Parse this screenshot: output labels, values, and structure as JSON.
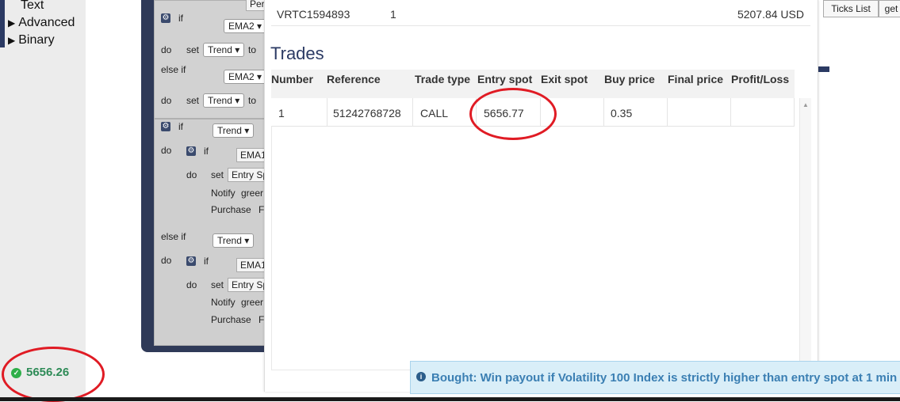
{
  "toolbox": {
    "categories": [
      "Text",
      "Advanced",
      "Binary"
    ],
    "status_value": "5656.26"
  },
  "workspace": {
    "blocks": {
      "if": "if",
      "do": "do",
      "else_if": "else if",
      "set": "set",
      "to": "to",
      "notify": "Notify",
      "purchase": "Purchase",
      "trend": "Trend",
      "ema2": "EMA2",
      "ema1_trunc": "EMA1",
      "entry_trunc": "Entry Sp",
      "green_trunc": "greer",
      "purchase_trunc": "F",
      "top_trunc": "Per"
    },
    "ticks_list_label": "Ticks List",
    "get_label": "get"
  },
  "summary": {
    "account": "VRTC1594893",
    "count": "1",
    "balance": "5207.84 USD"
  },
  "trades": {
    "title": "Trades",
    "columns": [
      "Number",
      "Reference",
      "Trade type",
      "Entry spot",
      "Exit spot",
      "Buy price",
      "Final price",
      "Profit/Loss"
    ],
    "rows": [
      {
        "number": "1",
        "reference": "51242768728",
        "trade_type": "CALL",
        "entry_spot": "5656.77",
        "exit_spot": "",
        "buy_price": "0.35",
        "final_price": "",
        "profit_loss": ""
      }
    ]
  },
  "notification": {
    "message": "Bought: Win payout if Volatility 100 Index is strictly higher than entry spot at 1 min"
  },
  "colors": {
    "accent": "#2b3a63",
    "success": "#2faf4a",
    "info_text": "#3b7fb3",
    "annotation": "#e01b24"
  }
}
